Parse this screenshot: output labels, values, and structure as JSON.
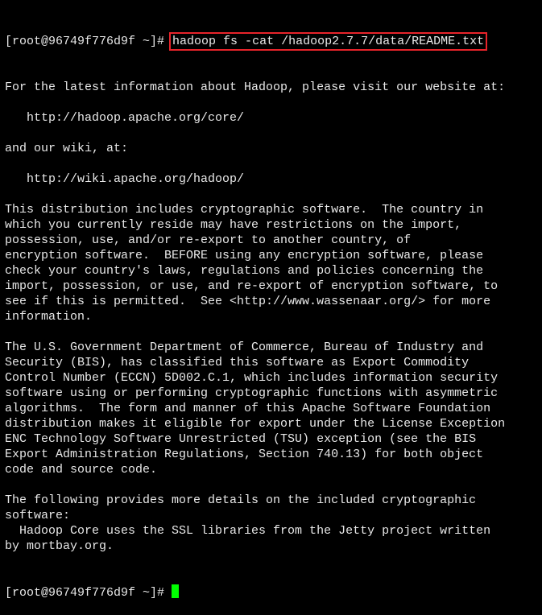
{
  "prompt": "[root@96749f776d9f ~]# ",
  "command": "hadoop fs -cat /hadoop2.7.7/data/README.txt",
  "output_lines": [
    "For the latest information about Hadoop, please visit our website at:",
    "",
    "   http://hadoop.apache.org/core/",
    "",
    "and our wiki, at:",
    "",
    "   http://wiki.apache.org/hadoop/",
    "",
    "This distribution includes cryptographic software.  The country in",
    "which you currently reside may have restrictions on the import,",
    "possession, use, and/or re-export to another country, of",
    "encryption software.  BEFORE using any encryption software, please",
    "check your country's laws, regulations and policies concerning the",
    "import, possession, or use, and re-export of encryption software, to",
    "see if this is permitted.  See <http://www.wassenaar.org/> for more",
    "information.",
    "",
    "The U.S. Government Department of Commerce, Bureau of Industry and",
    "Security (BIS), has classified this software as Export Commodity",
    "Control Number (ECCN) 5D002.C.1, which includes information security",
    "software using or performing cryptographic functions with asymmetric",
    "algorithms.  The form and manner of this Apache Software Foundation",
    "distribution makes it eligible for export under the License Exception",
    "ENC Technology Software Unrestricted (TSU) exception (see the BIS",
    "Export Administration Regulations, Section 740.13) for both object",
    "code and source code.",
    "",
    "The following provides more details on the included cryptographic",
    "software:",
    "  Hadoop Core uses the SSL libraries from the Jetty project written",
    "by mortbay.org."
  ],
  "final_prompt": "[root@96749f776d9f ~]# ",
  "colors": {
    "background": "#000000",
    "text": "#e8e8e8",
    "highlight_box": "#e8232a",
    "cursor": "#00ff00"
  }
}
